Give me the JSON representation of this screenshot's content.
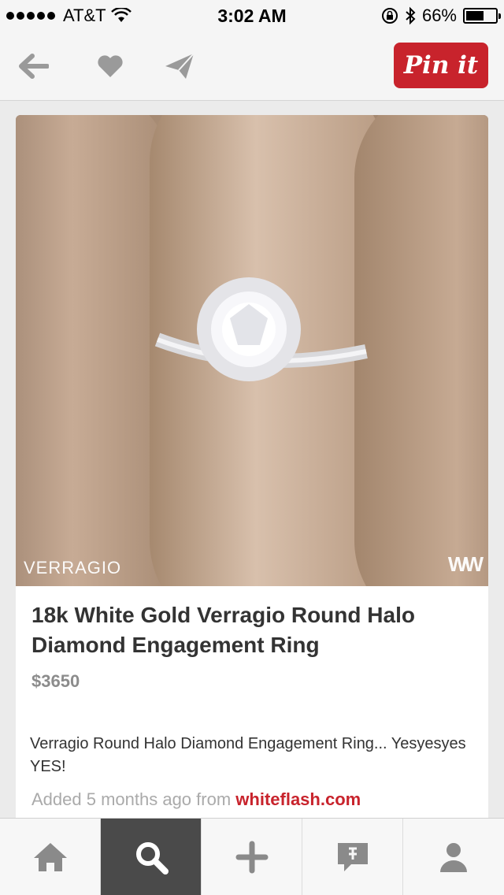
{
  "status_bar": {
    "carrier": "AT&T",
    "time": "3:02 AM",
    "battery_percent": "66%",
    "battery_level": 0.66
  },
  "toolbar": {
    "back_icon": "back-arrow-icon",
    "like_icon": "heart-icon",
    "send_icon": "send-icon",
    "pin_label": "Pin it",
    "pin_color": "#c8232c"
  },
  "pin": {
    "image_logo_left": "VERRAGIO",
    "image_logo_right": "WW",
    "title": "18k White Gold Verragio Round Halo Diamond Engagement Ring",
    "price": "$3650",
    "description": "Verragio Round Halo Diamond Engagement Ring... Yesyesyes YES!",
    "added_prefix": "Added 5 months ago from",
    "source": "whiteflash.com"
  },
  "tabbar": {
    "items": [
      {
        "icon": "home-icon",
        "active": false
      },
      {
        "icon": "search-icon",
        "active": true
      },
      {
        "icon": "plus-icon",
        "active": false
      },
      {
        "icon": "news-icon",
        "active": false
      },
      {
        "icon": "profile-icon",
        "active": false
      }
    ]
  }
}
